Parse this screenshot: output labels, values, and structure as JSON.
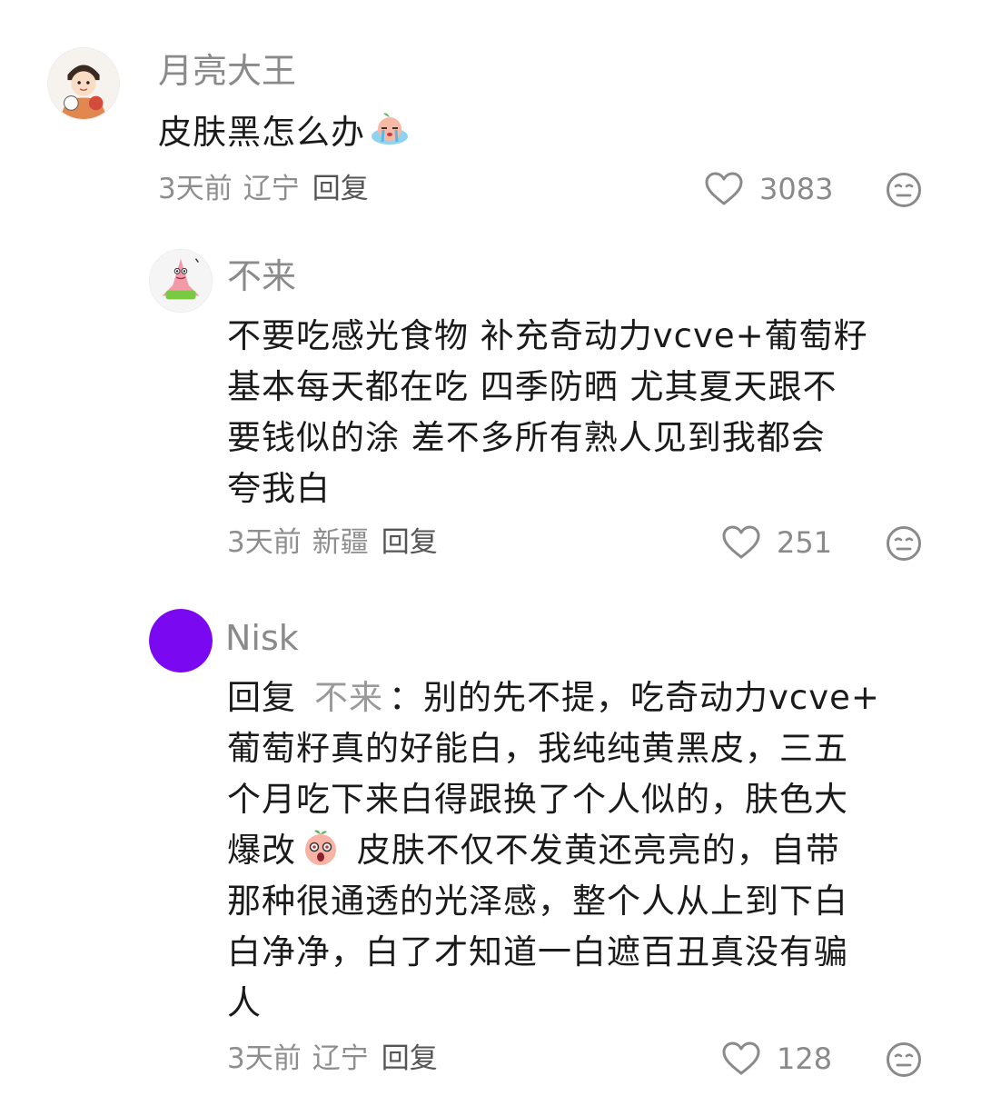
{
  "comments": [
    {
      "author": "月亮大王",
      "avatar_icon": "cartoon-kid-avatar-icon",
      "content_line1": "皮肤黑怎么办",
      "emoji": "crying-peach-emoji-icon",
      "time": "3天前",
      "region": "辽宁",
      "reply_label": "回复",
      "likes": "3083"
    },
    {
      "author": "不来",
      "avatar_icon": "patrick-star-avatar-icon",
      "content_lines": [
        "不要吃感光食物 补充奇动力vcve+葡萄籽",
        "基本每天都在吃 四季防晒 尤其夏天跟不",
        "要钱似的涂 差不多所有熟人见到我都会",
        "夸我白"
      ],
      "time": "3天前",
      "region": "新疆",
      "reply_label": "回复",
      "likes": "251"
    },
    {
      "author": "Nisk",
      "avatar_color": "#7a08f0",
      "reply_prefix": "回复",
      "mention": "不来",
      "line1_rest": "：别的先不提，吃奇动力vcve+",
      "content_lines": [
        "葡萄籽真的好能白，我纯纯黄黑皮，三五",
        "个月吃下来白得跟换了个人似的，肤色大"
      ],
      "line4_start": "爆改",
      "emoji": "surprised-peach-emoji-icon",
      "line4_rest": " 皮肤不仅不发黄还亮亮的，自带",
      "content_lines_end": [
        "那种很通透的光泽感，整个人从上到下白",
        "白净净，白了才知道一白遮百丑真没有骗",
        "人"
      ],
      "time": "3天前",
      "region": "辽宁",
      "reply_label": "回复",
      "likes": "128"
    }
  ],
  "icons": {
    "like": "heart-outline-icon",
    "dislike": "meh-face-icon"
  },
  "colors": {
    "meta_gray": "#8e8e8e",
    "author_gray": "#8a8a8a",
    "text": "#1a1a1a",
    "nisk_avatar": "#7a08f0"
  }
}
